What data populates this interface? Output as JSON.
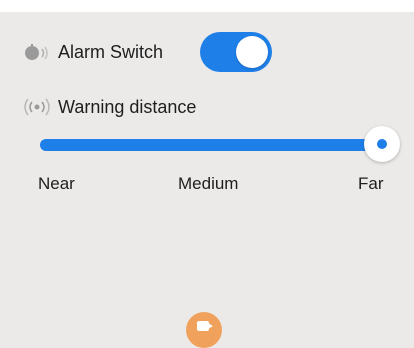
{
  "alarm": {
    "icon": "alarm-speaker-icon",
    "label": "Alarm Switch",
    "enabled": true
  },
  "warning": {
    "icon": "signal-broadcast-icon",
    "label": "Warning distance",
    "options": [
      "Near",
      "Medium",
      "Far"
    ],
    "selected": "Far"
  },
  "colors": {
    "accent": "#1f7fe8",
    "background": "#eceae9",
    "camera_button": "#f0a25d"
  },
  "camera": {
    "icon": "video-camera-icon"
  }
}
